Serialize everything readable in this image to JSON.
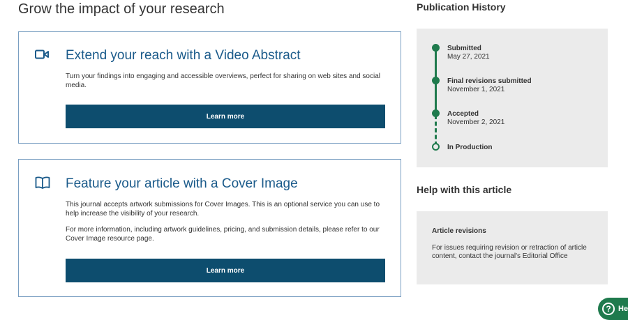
{
  "main": {
    "section_title": "Grow the impact of your research",
    "cards": [
      {
        "icon": "video-icon",
        "heading": "Extend your reach with a Video Abstract",
        "paragraphs": [
          "Turn your findings into engaging and accessible overviews, perfect for sharing on web sites and social media."
        ],
        "button_label": "Learn more"
      },
      {
        "icon": "book-icon",
        "heading": "Feature your article with a Cover Image",
        "paragraphs": [
          "This journal accepts artwork submissions for Cover Images. This is an optional service you can use to help increase the visibility of your research.",
          "For more information, including artwork guidelines, pricing, and submission details, please refer to our Cover Image resource page."
        ],
        "button_label": "Learn more"
      }
    ]
  },
  "sidebar": {
    "publication_history": {
      "title": "Publication History",
      "steps": [
        {
          "label": "Submitted",
          "date": "May 27, 2021"
        },
        {
          "label": "Final revisions submitted",
          "date": "November 1, 2021"
        },
        {
          "label": "Accepted",
          "date": "November 2, 2021"
        },
        {
          "label": "In Production",
          "date": ""
        }
      ]
    },
    "help": {
      "title": "Help with this article",
      "heading": "Article revisions",
      "text": "For issues requiring revision or retraction of article content, contact the journal's Editorial Office"
    }
  },
  "help_widget": {
    "icon": "question-icon",
    "symbol": "?",
    "label": "He"
  },
  "colors": {
    "accent_blue": "#1a5a8a",
    "button": "#0d4d6e",
    "timeline_green": "#1f7a4d",
    "panel_bg": "#ebebeb"
  }
}
